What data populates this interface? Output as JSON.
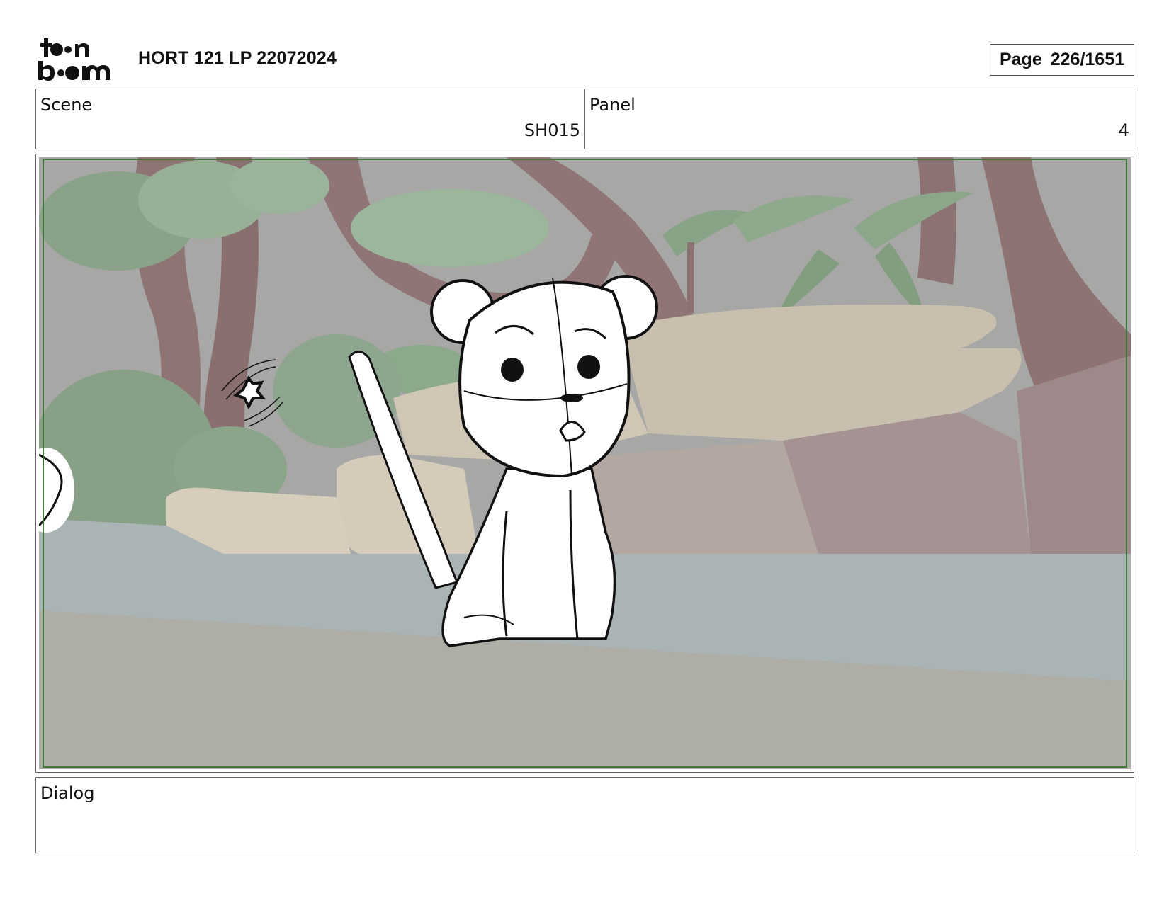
{
  "header": {
    "logo_text": "toon boom",
    "title": "HORT 121 LP 22072024",
    "page_label": "Page",
    "page_value": "226/1651"
  },
  "info": {
    "scene_label": "Scene",
    "scene_value": "SH015",
    "panel_label": "Panel",
    "panel_value": "4"
  },
  "dialog": {
    "label": "Dialog",
    "text": ""
  },
  "colors": {
    "safe_frame": "#3c7a35",
    "border": "#666666"
  }
}
